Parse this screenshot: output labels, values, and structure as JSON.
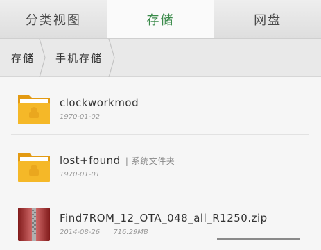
{
  "tabs": [
    {
      "label": "分类视图",
      "active": false
    },
    {
      "label": "存储",
      "active": true
    },
    {
      "label": "网盘",
      "active": false
    }
  ],
  "breadcrumb": [
    "存储",
    "手机存储"
  ],
  "files": [
    {
      "name": "clockworkmod",
      "subtitle": "",
      "date": "1970-01-02",
      "size": "",
      "icon": "folder-icon"
    },
    {
      "name": "lost+found",
      "subtitle": "| 系统文件夹",
      "date": "1970-01-01",
      "size": "",
      "icon": "folder-icon"
    },
    {
      "name": "Find7ROM_12_OTA_048_all_R1250.zip",
      "subtitle": "",
      "date": "2014-08-26",
      "size": "716.29MB",
      "icon": "zip-archive-icon"
    }
  ],
  "colors": {
    "active_tab_text": "#3a8a4a",
    "folder": "#f2b01e",
    "zip": "#c62828"
  }
}
